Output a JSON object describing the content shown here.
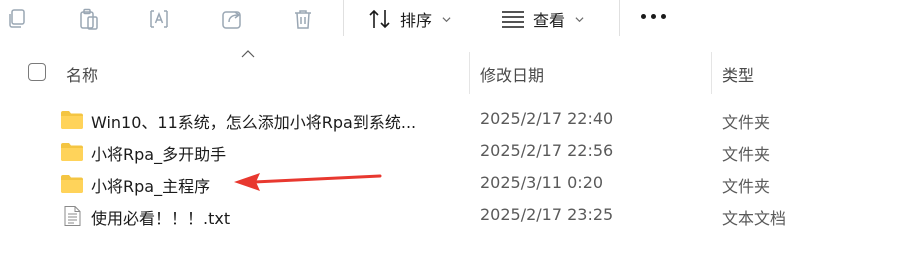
{
  "toolbar": {
    "icons": [
      "copy-icon",
      "paste-icon",
      "rename-icon",
      "share-icon",
      "delete-icon"
    ],
    "sort_label": "排序",
    "view_label": "查看",
    "more_label": "更多"
  },
  "columns": {
    "name": "名称",
    "date": "修改日期",
    "type": "类型"
  },
  "files": [
    {
      "name": "Win10、11系统，怎么添加小将Rpa到系统...",
      "date": "2025/2/17 22:40",
      "type": "文件夹",
      "icon": "folder-icon"
    },
    {
      "name": "小将Rpa_多开助手",
      "date": "2025/2/17 22:56",
      "type": "文件夹",
      "icon": "folder-icon"
    },
    {
      "name": "小将Rpa_主程序",
      "date": "2025/3/11 0:20",
      "type": "文件夹",
      "icon": "folder-icon"
    },
    {
      "name": "使用必看！！！.txt",
      "date": "2025/2/17 23:25",
      "type": "文本文档",
      "icon": "text-file-icon"
    }
  ],
  "colors": {
    "folder": "#f4c542",
    "arrow": "#e8382f",
    "icon_disabled": "#9aa7b4"
  }
}
